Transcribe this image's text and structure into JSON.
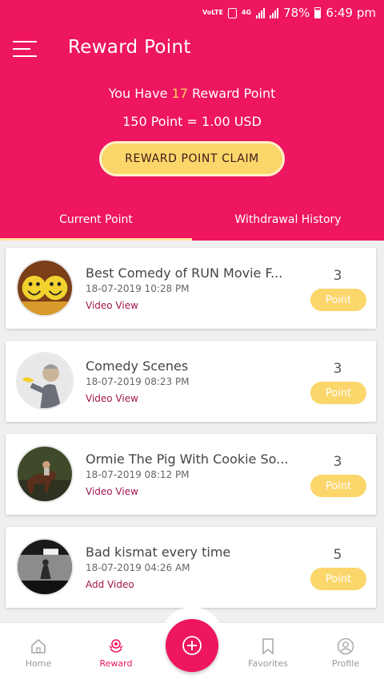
{
  "status_bar": {
    "network": "VoLTE",
    "signal": "4G",
    "battery": "78%",
    "time": "6:49 pm"
  },
  "header": {
    "title": "Reward Point",
    "have_prefix": "You Have",
    "points": "17",
    "have_suffix": "Reward Point",
    "rate": "150 Point = 1.00 USD",
    "claim_label": "REWARD POINT CLAIM"
  },
  "tabs": [
    {
      "label": "Current Point",
      "active": true
    },
    {
      "label": "Withdrawal History",
      "active": false
    }
  ],
  "rewards": [
    {
      "title": "Best Comedy of RUN Movie F...",
      "date": "18-07-2019  10:28 PM",
      "type": "Video View",
      "points": "3",
      "badge": "Point",
      "thumb": "smiley-faces"
    },
    {
      "title": "Comedy Scenes",
      "date": "18-07-2019  08:23 PM",
      "type": "Video View",
      "points": "3",
      "badge": "Point",
      "thumb": "man-with-banana"
    },
    {
      "title": "Ormie The Pig With Cookie So...",
      "date": "18-07-2019  08:12 PM",
      "type": "Video View",
      "points": "3",
      "badge": "Point",
      "thumb": "horse-rider"
    },
    {
      "title": "Bad kismat every time",
      "date": "18-07-2019  04:26 AM",
      "type": "Add Video",
      "points": "5",
      "badge": "Point",
      "thumb": "street-scene"
    }
  ],
  "bottom_nav": {
    "home": "Home",
    "reward": "Reward",
    "favorites": "Favorites",
    "profile": "Profile"
  },
  "colors": {
    "primary": "#ee1561",
    "accent": "#fbd66b",
    "link": "#a0174f"
  }
}
